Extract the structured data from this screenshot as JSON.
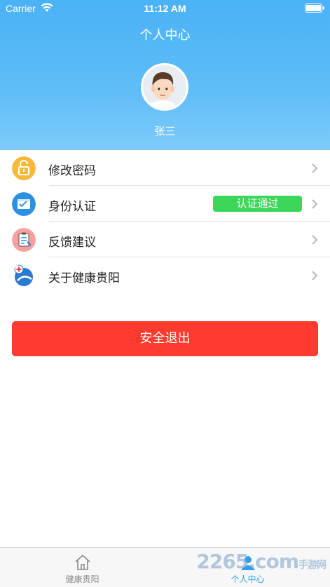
{
  "status_bar": {
    "carrier": "Carrier",
    "time": "11:12 AM"
  },
  "header": {
    "title": "个人中心",
    "user_name": "张三"
  },
  "menu": {
    "items": [
      {
        "label": "修改密码",
        "icon": "lock-icon",
        "color": "#f8b93b"
      },
      {
        "label": "身份认证",
        "icon": "id-card-icon",
        "color": "#2c8fe0",
        "badge": "认证通过"
      },
      {
        "label": "反馈建议",
        "icon": "clipboard-icon",
        "color": "#f7a0a0"
      },
      {
        "label": "关于健康贵阳",
        "icon": "info-globe-icon",
        "color": "#2a7ad4"
      }
    ]
  },
  "logout": {
    "label": "安全退出",
    "color": "#ff3b30"
  },
  "tabbar": {
    "tabs": [
      {
        "label": "健康贵阳",
        "icon": "home-icon",
        "active": false
      },
      {
        "label": "个人中心",
        "icon": "person-icon",
        "active": true
      }
    ]
  },
  "watermark": {
    "text": "2265.com",
    "suffix": "手游网"
  }
}
